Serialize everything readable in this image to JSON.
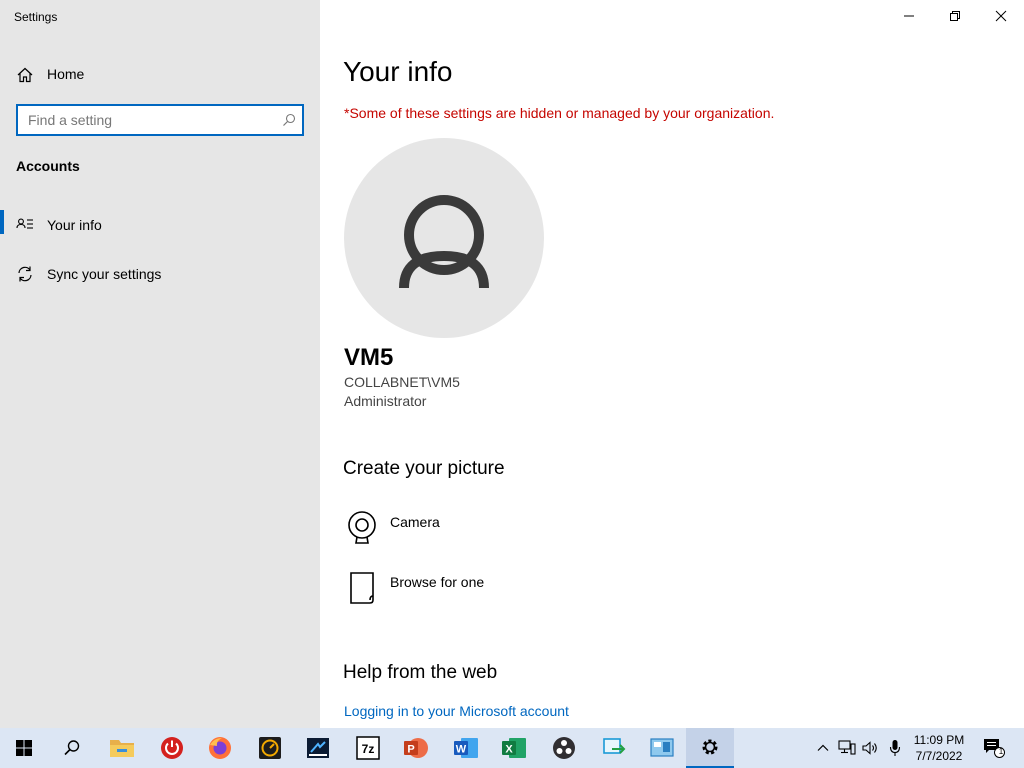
{
  "window": {
    "title": "Settings",
    "controls": {
      "minimize": "minimize-icon",
      "maximize": "restore-icon",
      "close": "close-icon"
    }
  },
  "sidebar": {
    "home_label": "Home",
    "search_placeholder": "Find a setting",
    "search_value": "",
    "section_heading": "Accounts",
    "items": [
      {
        "label": "Your info",
        "icon": "person-card-icon",
        "selected": true
      },
      {
        "label": "Sync your settings",
        "icon": "sync-icon",
        "selected": false
      }
    ]
  },
  "main": {
    "title": "Your info",
    "org_warning": "*Some of these settings are hidden or managed by your organization.",
    "user": {
      "name": "VM5",
      "account": "COLLABNET\\VM5",
      "role": "Administrator"
    },
    "create_picture": {
      "title": "Create your picture",
      "options": [
        {
          "label": "Camera",
          "icon": "camera-icon"
        },
        {
          "label": "Browse for one",
          "icon": "browse-file-icon"
        }
      ]
    },
    "help": {
      "title": "Help from the web",
      "link": "Logging in to your Microsoft account"
    }
  },
  "taskbar": {
    "apps": [
      "start-icon",
      "search-icon",
      "file-explorer-icon",
      "power-app-icon",
      "firefox-icon",
      "app-icon",
      "app-icon",
      "7zip-icon",
      "powerpoint-icon",
      "word-icon",
      "excel-icon",
      "obs-icon",
      "app-icon",
      "app-icon",
      "settings-gear-icon"
    ],
    "clock": {
      "time": "11:09 PM",
      "date": "7/7/2022"
    },
    "notification_count": "1"
  },
  "colors": {
    "accent": "#0067c0",
    "warning": "#c50500",
    "sidebar_bg": "#e6e6e6",
    "taskbar_bg": "#dce6f4"
  }
}
